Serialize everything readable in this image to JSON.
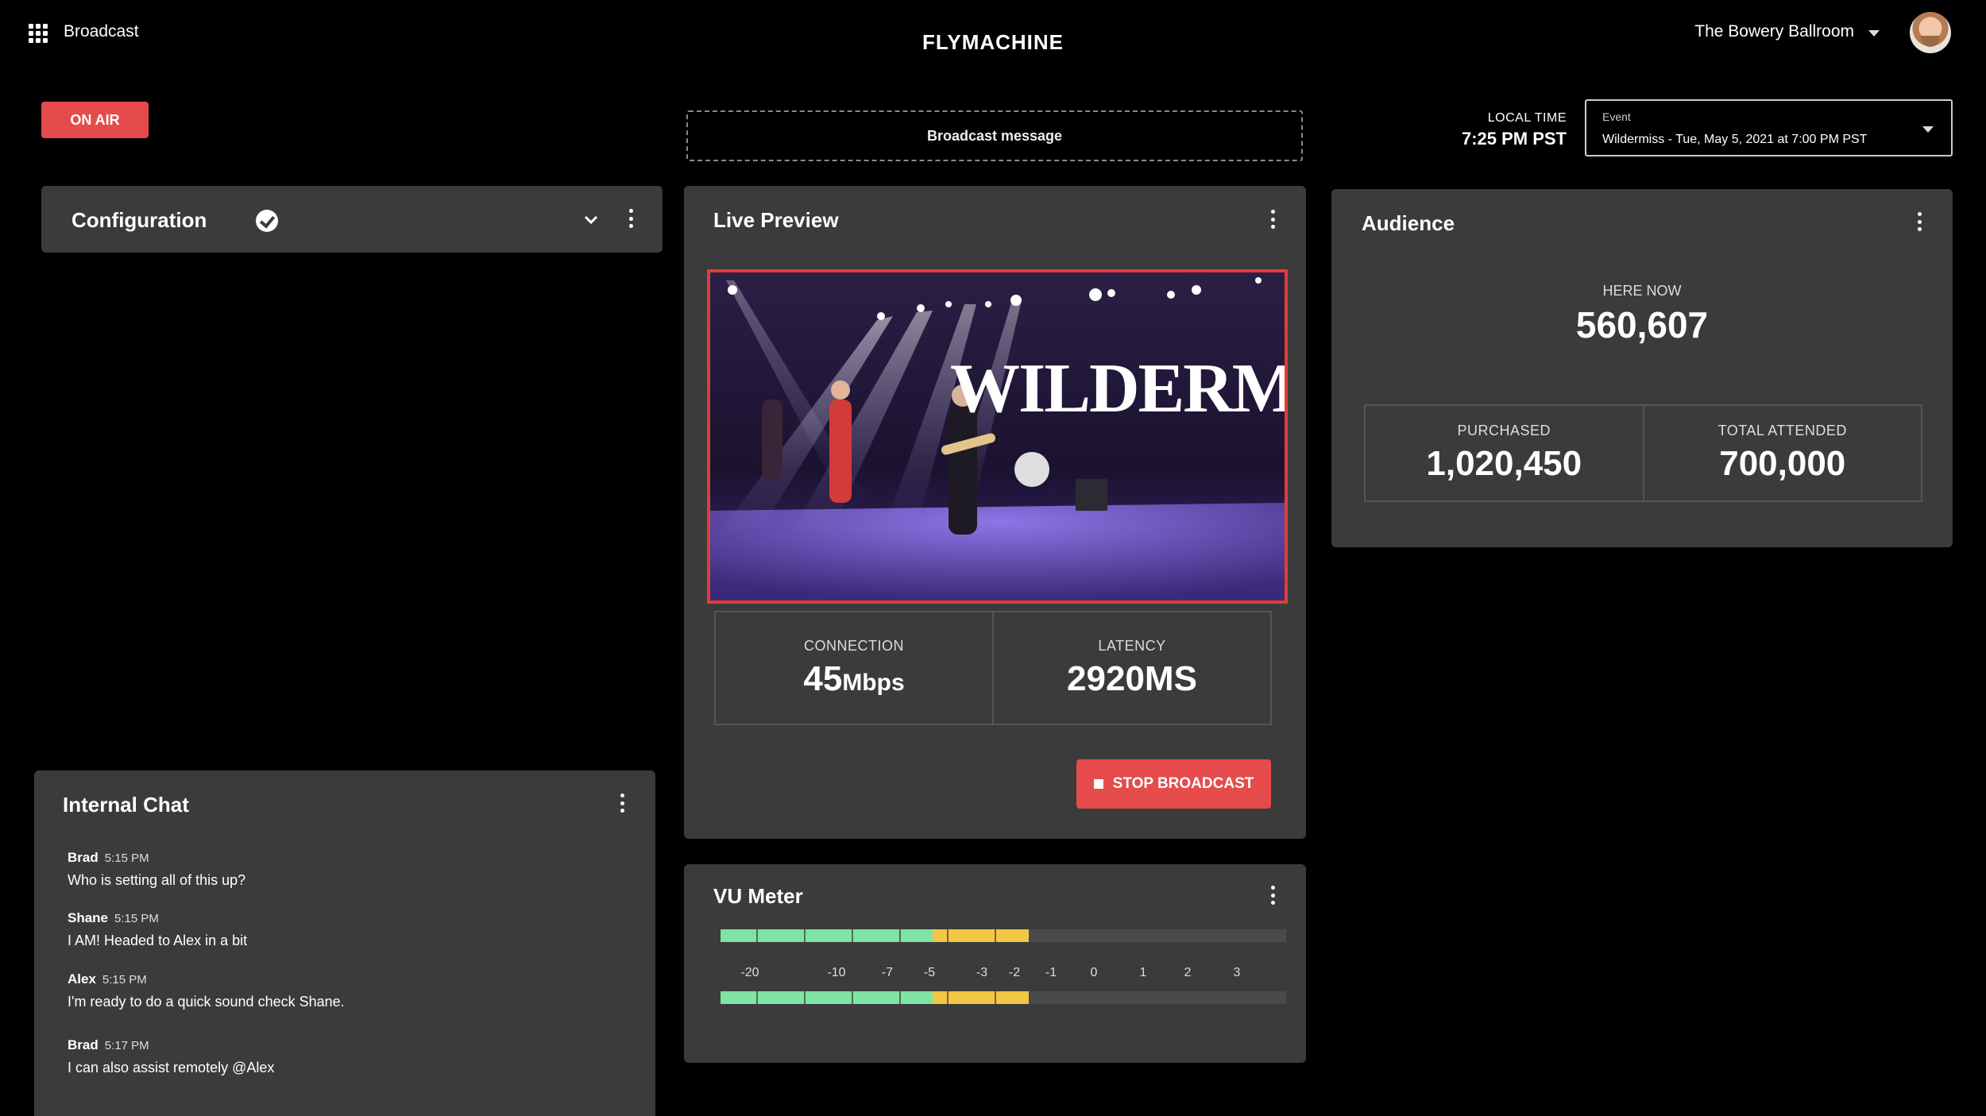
{
  "header": {
    "app_name": "Broadcast",
    "logo": "FLYMACHINE",
    "venue": "The Bowery Ballroom"
  },
  "status": {
    "on_air": "ON AIR"
  },
  "broadcast_message": {
    "label": "Broadcast message"
  },
  "local_time": {
    "label": "LOCAL TIME",
    "value": "7:25 PM PST"
  },
  "event": {
    "label": "Event",
    "value": "Wildermiss - Tue, May 5, 2021 at 7:00 PM PST"
  },
  "configuration": {
    "title": "Configuration"
  },
  "live_preview": {
    "title": "Live Preview",
    "video_overlay_text": "WILDERMISS",
    "connection_label": "CONNECTION",
    "connection_value": "45",
    "connection_unit": "Mbps",
    "latency_label": "LATENCY",
    "latency_value": "2920MS",
    "stop_label": "STOP BROADCAST"
  },
  "vu_meter": {
    "title": "VU Meter",
    "scale": [
      "-20",
      "-10",
      "-7",
      "-5",
      "-3",
      "-2",
      "-1",
      "0",
      "1",
      "2",
      "3"
    ],
    "level_green_fraction": 0.375,
    "level_yellow_fraction": 0.17,
    "colors": {
      "green": "#7ee3a4",
      "yellow": "#f2c744",
      "track": "#4a4a4a"
    }
  },
  "audience": {
    "title": "Audience",
    "here_now_label": "HERE NOW",
    "here_now_value": "560,607",
    "purchased_label": "PURCHASED",
    "purchased_value": "1,020,450",
    "attended_label": "TOTAL ATTENDED",
    "attended_value": "700,000"
  },
  "chat": {
    "title": "Internal Chat",
    "messages": [
      {
        "name": "Brad",
        "time": "5:15 PM",
        "text": "Who is setting all of this up?"
      },
      {
        "name": "Shane",
        "time": "5:15 PM",
        "text": "I AM! Headed to Alex in a bit"
      },
      {
        "name": "Alex",
        "time": "5:15 PM",
        "text": "I'm ready to do a quick sound check Shane."
      },
      {
        "name": "Brad",
        "time": "5:17 PM",
        "text": "I can also assist remotely @Alex"
      }
    ]
  },
  "colors": {
    "accent_red": "#e64b4b",
    "card_bg": "#3b3b3b",
    "page_bg": "#000000"
  }
}
